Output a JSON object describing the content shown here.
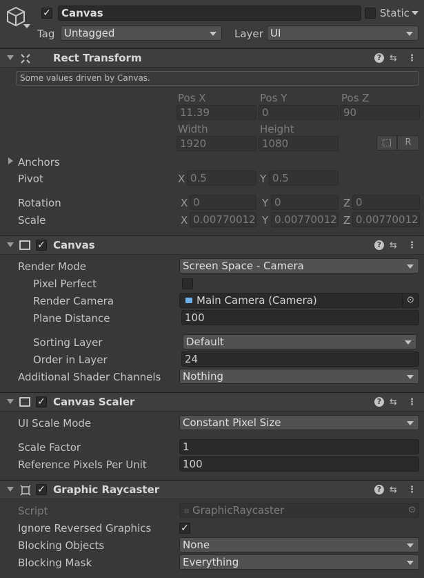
{
  "gameobject": {
    "name": "Canvas",
    "active_checked": true,
    "static_label": "Static",
    "tag_label": "Tag",
    "tag_value": "Untagged",
    "layer_label": "Layer",
    "layer_value": "UI"
  },
  "rect_transform": {
    "title": "Rect Transform",
    "driven_note": "Some values driven by Canvas.",
    "pos_x_label": "Pos X",
    "pos_y_label": "Pos Y",
    "pos_z_label": "Pos Z",
    "pos_x": "11.39",
    "pos_y": "0",
    "pos_z": "90",
    "width_label": "Width",
    "height_label": "Height",
    "width": "1920",
    "height": "1080",
    "anchors_label": "Anchors",
    "pivot_label": "Pivot",
    "pivot_x_label": "X",
    "pivot_y_label": "Y",
    "pivot_x": "0.5",
    "pivot_y": "0.5",
    "rotation_label": "Rotation",
    "rot_x": "0",
    "rot_y": "0",
    "rot_z": "0",
    "scale_label": "Scale",
    "scale_x": "0.00770012",
    "scale_y": "0.00770012",
    "scale_z": "0.00770012",
    "x_label": "X",
    "y_label": "Y",
    "z_label": "Z",
    "raw_button_label": "R"
  },
  "canvas": {
    "title": "Canvas",
    "enabled": true,
    "render_mode_label": "Render Mode",
    "render_mode": "Screen Space - Camera",
    "pixel_perfect_label": "Pixel Perfect",
    "pixel_perfect": false,
    "render_camera_label": "Render Camera",
    "render_camera": "Main Camera (Camera)",
    "plane_distance_label": "Plane Distance",
    "plane_distance": "100",
    "sorting_layer_label": "Sorting Layer",
    "sorting_layer": "Default",
    "order_in_layer_label": "Order in Layer",
    "order_in_layer": "24",
    "shader_channels_label": "Additional Shader Channels",
    "shader_channels": "Nothing"
  },
  "canvas_scaler": {
    "title": "Canvas Scaler",
    "enabled": true,
    "ui_scale_mode_label": "UI Scale Mode",
    "ui_scale_mode": "Constant Pixel Size",
    "scale_factor_label": "Scale Factor",
    "scale_factor": "1",
    "ref_ppu_label": "Reference Pixels Per Unit",
    "ref_ppu": "100"
  },
  "graphic_raycaster": {
    "title": "Graphic Raycaster",
    "enabled": true,
    "script_label": "Script",
    "script": "GraphicRaycaster",
    "ignore_reversed_label": "Ignore Reversed Graphics",
    "ignore_reversed": true,
    "blocking_objects_label": "Blocking Objects",
    "blocking_objects": "None",
    "blocking_mask_label": "Blocking Mask",
    "blocking_mask": "Everything"
  },
  "icons": {
    "gameobject": "cube-icon",
    "help": "help-icon",
    "presets": "presets-icon",
    "menu": "kebab-menu-icon",
    "check": "✓"
  }
}
